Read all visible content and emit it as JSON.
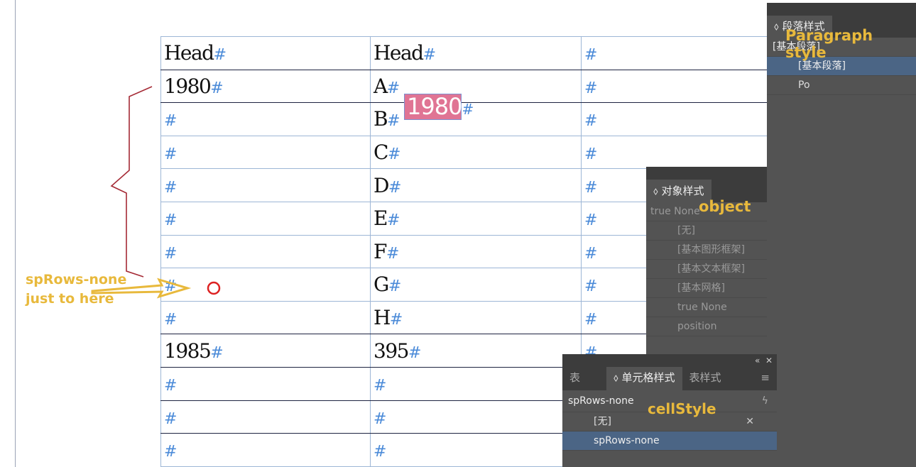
{
  "table": {
    "rows": [
      [
        "Head",
        "Head",
        ""
      ],
      [
        "1980",
        "A",
        ""
      ],
      [
        "",
        "B",
        ""
      ],
      [
        "",
        "C",
        ""
      ],
      [
        "",
        "D",
        ""
      ],
      [
        "",
        "E",
        ""
      ],
      [
        "",
        "F",
        ""
      ],
      [
        "",
        "G",
        ""
      ],
      [
        "",
        "H",
        ""
      ],
      [
        "1985",
        "395",
        ""
      ],
      [
        "",
        "",
        ""
      ],
      [
        "",
        "",
        ""
      ],
      [
        "",
        "",
        ""
      ]
    ],
    "marker": "#"
  },
  "floating_tag": "1980",
  "paragraph_panel": {
    "tab": "段落样式",
    "current": "[基本段落]",
    "items": [
      "[基本段落]",
      "Po"
    ],
    "annotation": "Paragraph style"
  },
  "object_panel": {
    "tab": "对象样式",
    "current": "true None",
    "items": [
      "[无]",
      "[基本图形框架]",
      "[基本文本框架]",
      "[基本网格]",
      "true None",
      "position"
    ],
    "annotation": "object"
  },
  "cell_panel": {
    "tabs": [
      "表",
      "单元格样式",
      "表样式"
    ],
    "current": "spRows-none",
    "items": [
      "[无]",
      "spRows-none"
    ],
    "annotation": "cellStyle"
  },
  "annotation": {
    "line1": "spRows-none",
    "line2": "just to here"
  }
}
